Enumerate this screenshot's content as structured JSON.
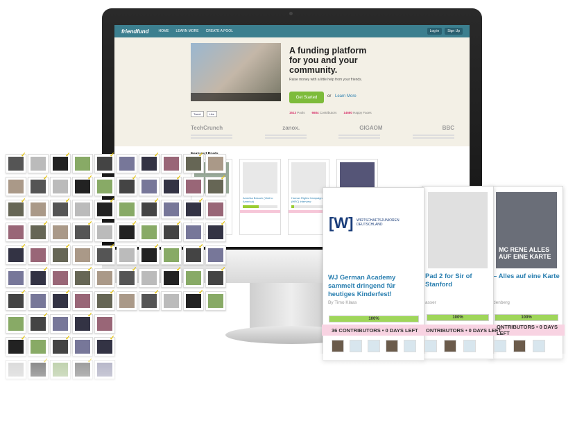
{
  "site": {
    "logo": "friendfund",
    "nav": [
      "HOME",
      "LEARN MORE",
      "CREATE A POOL"
    ],
    "nav_right": [
      "Log in",
      "Sign Up"
    ],
    "headline": "A funding platform for you and your community.",
    "subline": "Raise money with a little help from your friends.",
    "get_started": "Get Started",
    "or": "or",
    "learn_more": "Learn More",
    "stats": [
      {
        "n": "1513",
        "l": "Pools"
      },
      {
        "n": "6684",
        "l": "Contributors"
      },
      {
        "n": "14680",
        "l": "Happy Faces"
      }
    ],
    "social": [
      "Tweet",
      "Like"
    ],
    "press": [
      "TechCrunch",
      "zanox.",
      "GIGAOM",
      "BBC"
    ],
    "featured_title": "Featured Pools",
    "cards": [
      {
        "title": "",
        "pct": ""
      },
      {
        "title": "Amerika Besuch (Visit to America)",
        "pct": "45%"
      },
      {
        "title": "Human Rights Campaign (HRC) Interview",
        "pct": "8%"
      },
      {
        "title": "",
        "pct": ""
      }
    ]
  },
  "overlay": [
    {
      "logo": "[W]",
      "logo_text": "WIRTSCHAFTSJUNIOREN DEUTSCHLAND",
      "title": "WJ German Academy sammelt dringend für heutiges Kinderfest!",
      "by": "By Timo Klaas",
      "pct": "100%"
    },
    {
      "title": "Pad 2 for Sir of Stanford",
      "by": "asser",
      "pct": "100%"
    },
    {
      "title": "– Alles auf eine Karte",
      "by": "denberg",
      "pct": "100%",
      "img_text": "MC RENE ALLES AUF EINE KARTE"
    }
  ],
  "contrib_bar": {
    "left": "36 CONTRIBUTORS • 0 DAYS LEFT",
    "mid": "ONTRIBUTORS • 0 DAYS LEFT",
    "right": "ONTRIBUTORS • 0 DAYS LEFT"
  },
  "colors": {
    "accent": "#3c7f8f",
    "green": "#9fd65a",
    "pink": "#f8d3e2",
    "link": "#2a7fb0",
    "check": "#e6c50d"
  }
}
